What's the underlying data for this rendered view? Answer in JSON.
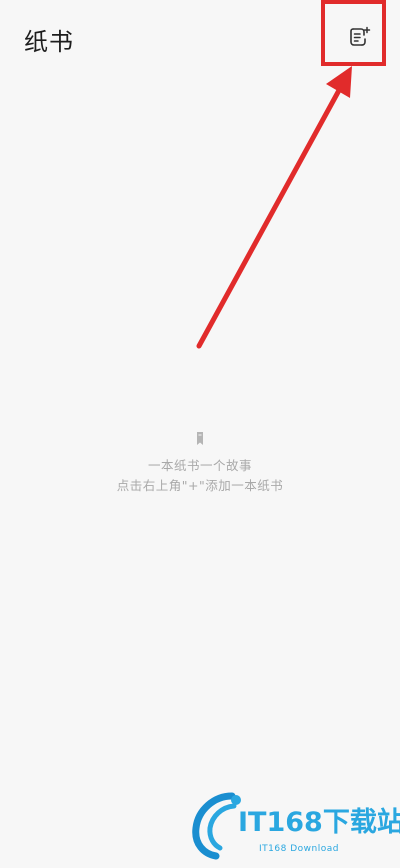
{
  "header": {
    "title": "纸书",
    "new_book_icon": "add-note-icon"
  },
  "empty_state": {
    "icon": "bookmark-icon",
    "line1": "一本纸书一个故事",
    "line2": "点击右上角\"+\"添加一本纸书"
  },
  "annotation": {
    "color": "#e12b2b"
  },
  "watermark": {
    "brand": "IT168下载站",
    "sub": "IT168 Download",
    "color": "#2aa7e0"
  }
}
